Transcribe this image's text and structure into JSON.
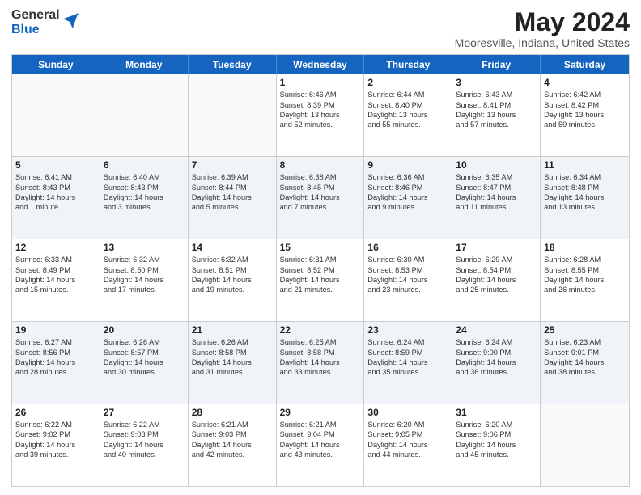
{
  "header": {
    "logo_general": "General",
    "logo_blue": "Blue",
    "title": "May 2024",
    "subtitle": "Mooresville, Indiana, United States"
  },
  "calendar": {
    "days_of_week": [
      "Sunday",
      "Monday",
      "Tuesday",
      "Wednesday",
      "Thursday",
      "Friday",
      "Saturday"
    ],
    "rows": [
      [
        {
          "day": "",
          "lines": []
        },
        {
          "day": "",
          "lines": []
        },
        {
          "day": "",
          "lines": []
        },
        {
          "day": "1",
          "lines": [
            "Sunrise: 6:46 AM",
            "Sunset: 8:39 PM",
            "Daylight: 13 hours",
            "and 52 minutes."
          ]
        },
        {
          "day": "2",
          "lines": [
            "Sunrise: 6:44 AM",
            "Sunset: 8:40 PM",
            "Daylight: 13 hours",
            "and 55 minutes."
          ]
        },
        {
          "day": "3",
          "lines": [
            "Sunrise: 6:43 AM",
            "Sunset: 8:41 PM",
            "Daylight: 13 hours",
            "and 57 minutes."
          ]
        },
        {
          "day": "4",
          "lines": [
            "Sunrise: 6:42 AM",
            "Sunset: 8:42 PM",
            "Daylight: 13 hours",
            "and 59 minutes."
          ]
        }
      ],
      [
        {
          "day": "5",
          "lines": [
            "Sunrise: 6:41 AM",
            "Sunset: 8:43 PM",
            "Daylight: 14 hours",
            "and 1 minute."
          ]
        },
        {
          "day": "6",
          "lines": [
            "Sunrise: 6:40 AM",
            "Sunset: 8:43 PM",
            "Daylight: 14 hours",
            "and 3 minutes."
          ]
        },
        {
          "day": "7",
          "lines": [
            "Sunrise: 6:39 AM",
            "Sunset: 8:44 PM",
            "Daylight: 14 hours",
            "and 5 minutes."
          ]
        },
        {
          "day": "8",
          "lines": [
            "Sunrise: 6:38 AM",
            "Sunset: 8:45 PM",
            "Daylight: 14 hours",
            "and 7 minutes."
          ]
        },
        {
          "day": "9",
          "lines": [
            "Sunrise: 6:36 AM",
            "Sunset: 8:46 PM",
            "Daylight: 14 hours",
            "and 9 minutes."
          ]
        },
        {
          "day": "10",
          "lines": [
            "Sunrise: 6:35 AM",
            "Sunset: 8:47 PM",
            "Daylight: 14 hours",
            "and 11 minutes."
          ]
        },
        {
          "day": "11",
          "lines": [
            "Sunrise: 6:34 AM",
            "Sunset: 8:48 PM",
            "Daylight: 14 hours",
            "and 13 minutes."
          ]
        }
      ],
      [
        {
          "day": "12",
          "lines": [
            "Sunrise: 6:33 AM",
            "Sunset: 8:49 PM",
            "Daylight: 14 hours",
            "and 15 minutes."
          ]
        },
        {
          "day": "13",
          "lines": [
            "Sunrise: 6:32 AM",
            "Sunset: 8:50 PM",
            "Daylight: 14 hours",
            "and 17 minutes."
          ]
        },
        {
          "day": "14",
          "lines": [
            "Sunrise: 6:32 AM",
            "Sunset: 8:51 PM",
            "Daylight: 14 hours",
            "and 19 minutes."
          ]
        },
        {
          "day": "15",
          "lines": [
            "Sunrise: 6:31 AM",
            "Sunset: 8:52 PM",
            "Daylight: 14 hours",
            "and 21 minutes."
          ]
        },
        {
          "day": "16",
          "lines": [
            "Sunrise: 6:30 AM",
            "Sunset: 8:53 PM",
            "Daylight: 14 hours",
            "and 23 minutes."
          ]
        },
        {
          "day": "17",
          "lines": [
            "Sunrise: 6:29 AM",
            "Sunset: 8:54 PM",
            "Daylight: 14 hours",
            "and 25 minutes."
          ]
        },
        {
          "day": "18",
          "lines": [
            "Sunrise: 6:28 AM",
            "Sunset: 8:55 PM",
            "Daylight: 14 hours",
            "and 26 minutes."
          ]
        }
      ],
      [
        {
          "day": "19",
          "lines": [
            "Sunrise: 6:27 AM",
            "Sunset: 8:56 PM",
            "Daylight: 14 hours",
            "and 28 minutes."
          ]
        },
        {
          "day": "20",
          "lines": [
            "Sunrise: 6:26 AM",
            "Sunset: 8:57 PM",
            "Daylight: 14 hours",
            "and 30 minutes."
          ]
        },
        {
          "day": "21",
          "lines": [
            "Sunrise: 6:26 AM",
            "Sunset: 8:58 PM",
            "Daylight: 14 hours",
            "and 31 minutes."
          ]
        },
        {
          "day": "22",
          "lines": [
            "Sunrise: 6:25 AM",
            "Sunset: 8:58 PM",
            "Daylight: 14 hours",
            "and 33 minutes."
          ]
        },
        {
          "day": "23",
          "lines": [
            "Sunrise: 6:24 AM",
            "Sunset: 8:59 PM",
            "Daylight: 14 hours",
            "and 35 minutes."
          ]
        },
        {
          "day": "24",
          "lines": [
            "Sunrise: 6:24 AM",
            "Sunset: 9:00 PM",
            "Daylight: 14 hours",
            "and 36 minutes."
          ]
        },
        {
          "day": "25",
          "lines": [
            "Sunrise: 6:23 AM",
            "Sunset: 9:01 PM",
            "Daylight: 14 hours",
            "and 38 minutes."
          ]
        }
      ],
      [
        {
          "day": "26",
          "lines": [
            "Sunrise: 6:22 AM",
            "Sunset: 9:02 PM",
            "Daylight: 14 hours",
            "and 39 minutes."
          ]
        },
        {
          "day": "27",
          "lines": [
            "Sunrise: 6:22 AM",
            "Sunset: 9:03 PM",
            "Daylight: 14 hours",
            "and 40 minutes."
          ]
        },
        {
          "day": "28",
          "lines": [
            "Sunrise: 6:21 AM",
            "Sunset: 9:03 PM",
            "Daylight: 14 hours",
            "and 42 minutes."
          ]
        },
        {
          "day": "29",
          "lines": [
            "Sunrise: 6:21 AM",
            "Sunset: 9:04 PM",
            "Daylight: 14 hours",
            "and 43 minutes."
          ]
        },
        {
          "day": "30",
          "lines": [
            "Sunrise: 6:20 AM",
            "Sunset: 9:05 PM",
            "Daylight: 14 hours",
            "and 44 minutes."
          ]
        },
        {
          "day": "31",
          "lines": [
            "Sunrise: 6:20 AM",
            "Sunset: 9:06 PM",
            "Daylight: 14 hours",
            "and 45 minutes."
          ]
        },
        {
          "day": "",
          "lines": []
        }
      ]
    ]
  }
}
